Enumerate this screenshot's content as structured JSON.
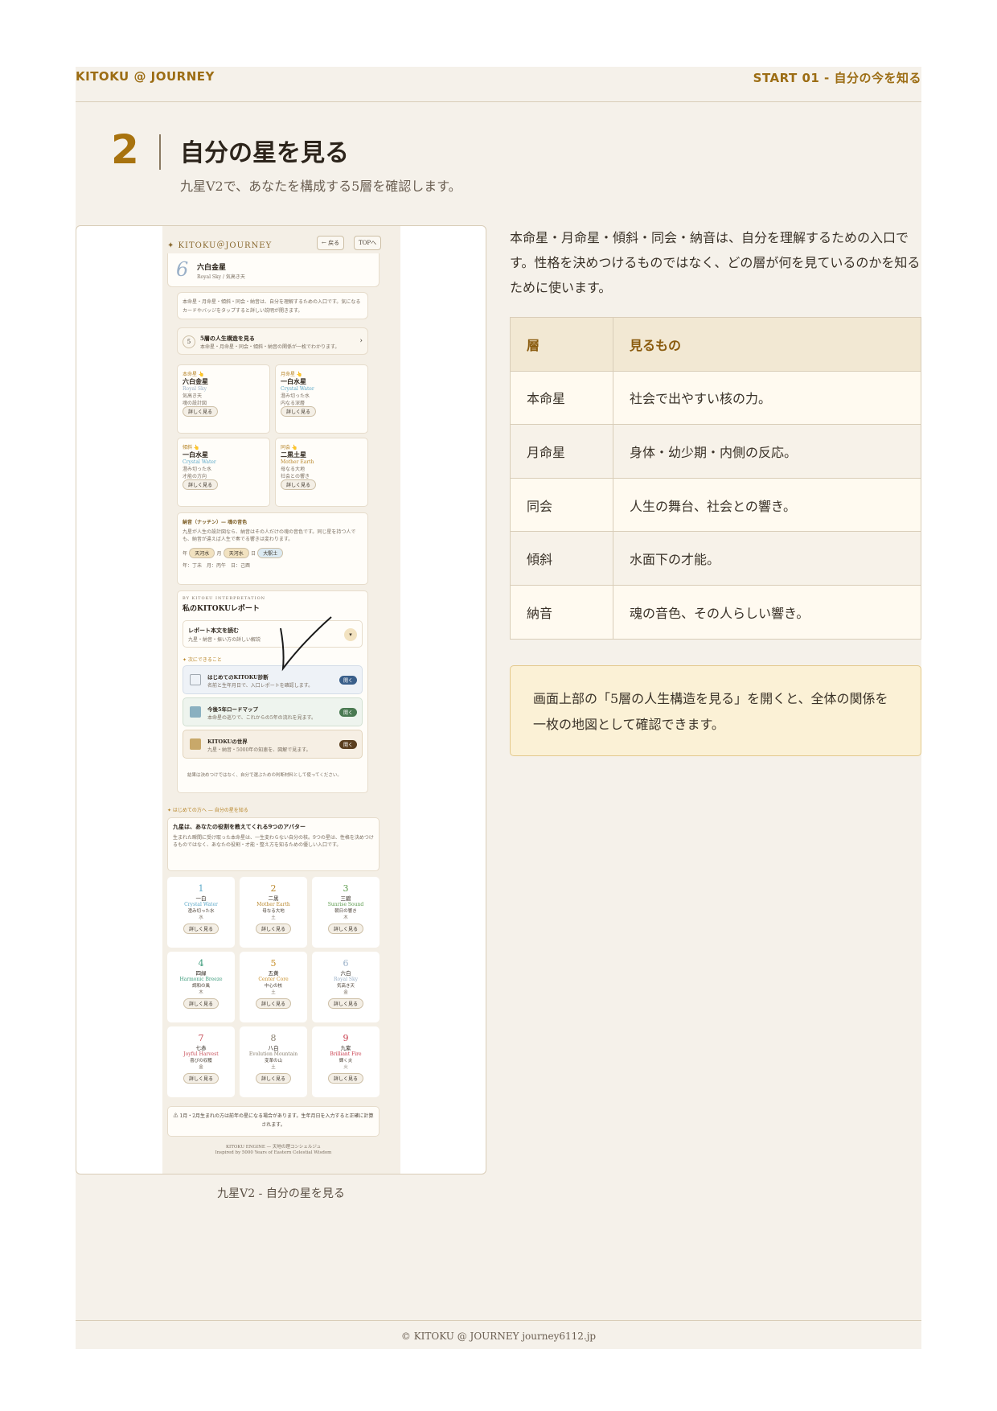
{
  "header": {
    "left": "KITOKU @ JOURNEY",
    "right": "START 01 - 自分の今を知る"
  },
  "section": {
    "number": "2",
    "title": "自分の星を見る",
    "subtitle": "九星V2で、あなたを構成する5層を確認します。"
  },
  "screenshot": {
    "caption": "九星V2 - 自分の星を見る",
    "app": {
      "logo": "✦ KITOKU＠JOURNEY",
      "back_btn": "← 戻る",
      "top_btn": "TOPへ",
      "star_number": "6",
      "star_name": "六白金星",
      "star_sub": "Royal Sky / 気高き天",
      "intro": "本命星・月命星・傾斜・同会・納音は、自分を理解するための入口です。気になるカードやバッジをタップすると詳しい説明が開きます。",
      "structure_num": "5",
      "structure_title": "5層の人生構造を見る",
      "structure_desc": "本命星・月命星・同会・傾斜・納音の関係が一枚でわかります。",
      "cards": [
        {
          "tag": "本命星 👆",
          "name": "六白金星",
          "en": "Royal Sky",
          "l1": "気高き天",
          "l2": "魂の設計図",
          "btn": "詳しく見る"
        },
        {
          "tag": "月命星 👆",
          "name": "一白水星",
          "en": "Crystal Water",
          "l1": "澄み切った水",
          "l2": "内なる深層",
          "btn": "詳しく見る"
        },
        {
          "tag": "傾斜 👆",
          "name": "一白水星",
          "en": "Crystal Water",
          "l1": "澄み切った水",
          "l2": "才能の方向",
          "btn": "詳しく見る"
        },
        {
          "tag": "同会 👆",
          "name": "二黒土星",
          "en": "Mother Earth",
          "l1": "母なる大地",
          "l2": "社会との響き",
          "btn": "詳しく見る"
        }
      ],
      "nattin_title": "納音（ナッチン）— 魂の音色",
      "nattin_desc": "九星が人生の設計図なら、納音はその人だけの魂の音色です。同じ星を持つ人でも、納音が違えば人生で奏でる響きは変わります。",
      "nattin_badges": [
        "年",
        "天河水",
        "月",
        "天河水",
        "日",
        "大駅土"
      ],
      "nattin_foot": "年：丁未　月：丙午　日：己酉",
      "report_eyebrow": "BY KITOKU INTERPRETATION",
      "report_title": "私のKITOKUレポート",
      "report_read": "レポート本文を読む",
      "report_read_sub": "九星・納音・振い方の詳しい解説",
      "next_label": "✦ 次にできること",
      "next_items": [
        {
          "title": "はじめてのKITOKU診断",
          "desc": "名前と生年月日で、入口レポートを確認します。",
          "btn": "開く",
          "color": "#3a5f8a"
        },
        {
          "title": "今後5年ロードマップ",
          "desc": "本命星の巡りで、これからの5年の流れを見ます。",
          "btn": "開く",
          "color": "#4a7a52"
        },
        {
          "title": "KITOKUの世界",
          "desc": "九星・納音・5000年の知恵を、図解で見ます。",
          "btn": "開く",
          "color": "#5a3e1e"
        }
      ],
      "next_note": "結果は決めつけではなく、自分で選ぶための判断材料として使ってください。",
      "beginner_label": "✦ はじめての方へ — 自分の星を知る",
      "beginner_title": "九星は、あなたの役割を教えてくれる9つのアバター",
      "beginner_desc": "生まれた瞬間に受け取った本命星は、一生変わらない自分の核。9つの星は、性格を決めつけるものではなく、あなたの役割・才能・整え方を知るための優しい入口です。",
      "stars": [
        {
          "n": "1",
          "kanji": "一白",
          "en": "Crystal Water",
          "jp": "澄み切った水",
          "el": "水",
          "color": "#5aa8c8"
        },
        {
          "n": "2",
          "kanji": "二黒",
          "en": "Mother Earth",
          "jp": "母なる大地",
          "el": "土",
          "color": "#b8862a"
        },
        {
          "n": "3",
          "kanji": "三碧",
          "en": "Sunrise Sound",
          "jp": "朝日の響き",
          "el": "木",
          "color": "#5a9a4a"
        },
        {
          "n": "4",
          "kanji": "四緑",
          "en": "Harmonic Breeze",
          "jp": "調和の風",
          "el": "木",
          "color": "#3a9a7a"
        },
        {
          "n": "5",
          "kanji": "五黄",
          "en": "Center Core",
          "jp": "中心の核",
          "el": "土",
          "color": "#c8902a"
        },
        {
          "n": "6",
          "kanji": "六白",
          "en": "Royal Sky",
          "jp": "気高き天",
          "el": "金",
          "color": "#9ab0c8"
        },
        {
          "n": "7",
          "kanji": "七赤",
          "en": "Joyful Harvest",
          "jp": "喜びの収穫",
          "el": "金",
          "color": "#c8505a"
        },
        {
          "n": "8",
          "kanji": "八白",
          "en": "Evolution Mountain",
          "jp": "変革の山",
          "el": "土",
          "color": "#8a8070"
        },
        {
          "n": "9",
          "kanji": "九紫",
          "en": "Brilliant Fire",
          "jp": "輝く炎",
          "el": "火",
          "color": "#c83a4a"
        }
      ],
      "star_btn": "詳しく見る",
      "warning": "⚠ 1月・2月生まれの方は前年の星になる場合があります。生年月日を入力すると正確に計算されます。",
      "footer1": "KITOKU ENGINE — 天地の理コンシェルジュ",
      "footer2": "Inspired by 5000 Years of Eastern Celestial Wisdom"
    }
  },
  "intro_text": "本命星・月命星・傾斜・同会・納音は、自分を理解するための入口です。性格を決めつけるものではなく、どの層が何を見ているのかを知るために使います。",
  "table": {
    "headers": [
      "層",
      "見るもの"
    ],
    "rows": [
      [
        "本命星",
        "社会で出やすい核の力。"
      ],
      [
        "月命星",
        "身体・幼少期・内側の反応。"
      ],
      [
        "同会",
        "人生の舞台、社会との響き。"
      ],
      [
        "傾斜",
        "水面下の才能。"
      ],
      [
        "納音",
        "魂の音色、その人らしい響き。"
      ]
    ]
  },
  "note": "画面上部の「5層の人生構造を見る」を開くと、全体の関係を一枚の地図として確認できます。",
  "footer": "© KITOKU @ JOURNEY journey6112.jp"
}
